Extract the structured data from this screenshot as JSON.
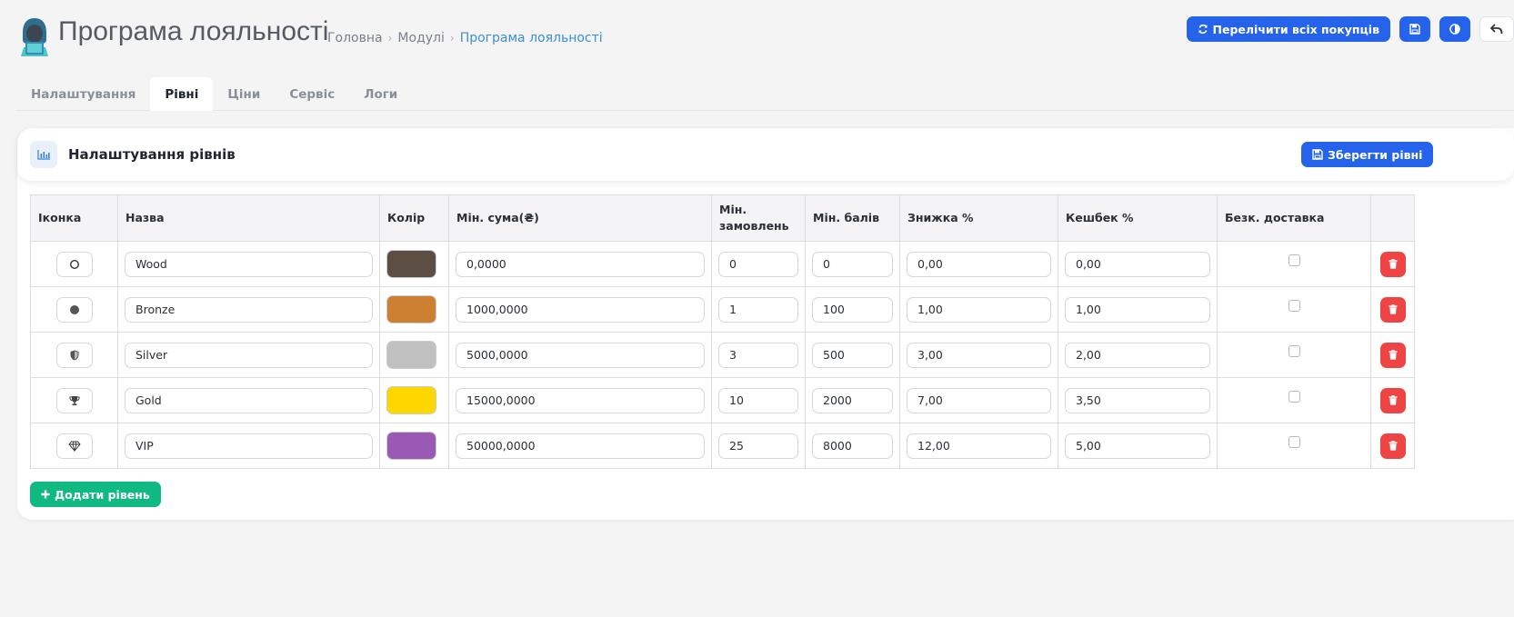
{
  "header": {
    "title": "Програма лояльності",
    "breadcrumb": [
      "Головна",
      "Модулі",
      "Програма лояльності"
    ],
    "recalc_label": "Перелічити всіх покупців"
  },
  "tabs": [
    {
      "label": "Налаштування",
      "active": false
    },
    {
      "label": "Рівні",
      "active": true
    },
    {
      "label": "Ціни",
      "active": false
    },
    {
      "label": "Сервіс",
      "active": false
    },
    {
      "label": "Логи",
      "active": false
    }
  ],
  "card": {
    "title": "Налаштування рівнів",
    "save_label": "Зберегти рівні",
    "add_label": "Додати рівень"
  },
  "table": {
    "headers": {
      "icon": "Іконка",
      "name": "Назва",
      "color": "Колір",
      "min_sum": "Мін. сума(₴)",
      "min_orders": "Мін. замовлень",
      "min_points": "Мін. балів",
      "discount": "Знижка %",
      "cashback": "Кешбек %",
      "free_delivery": "Безк. доставка"
    },
    "rows": [
      {
        "icon": "circle-outline-icon",
        "name": "Wood",
        "color": "#5c4e43",
        "min_sum": "0,0000",
        "min_orders": "0",
        "min_points": "0",
        "discount": "0,00",
        "cashback": "0,00",
        "free_delivery": false
      },
      {
        "icon": "circle-filled-icon",
        "name": "Bronze",
        "color": "#cd7f32",
        "min_sum": "1000,0000",
        "min_orders": "1",
        "min_points": "100",
        "discount": "1,00",
        "cashback": "1,00",
        "free_delivery": false
      },
      {
        "icon": "shield-icon",
        "name": "Silver",
        "color": "#c0c0c0",
        "min_sum": "5000,0000",
        "min_orders": "3",
        "min_points": "500",
        "discount": "3,00",
        "cashback": "2,00",
        "free_delivery": false
      },
      {
        "icon": "trophy-icon",
        "name": "Gold",
        "color": "#ffd700",
        "min_sum": "15000,0000",
        "min_orders": "10",
        "min_points": "2000",
        "discount": "7,00",
        "cashback": "3,50",
        "free_delivery": false
      },
      {
        "icon": "diamond-icon",
        "name": "VIP",
        "color": "#9b59b6",
        "min_sum": "50000,0000",
        "min_orders": "25",
        "min_points": "8000",
        "discount": "12,00",
        "cashback": "5,00",
        "free_delivery": false
      }
    ]
  },
  "colors": {
    "primary": "#2563eb",
    "success": "#10b981",
    "danger": "#ef4444",
    "link": "#3b8fd1"
  }
}
